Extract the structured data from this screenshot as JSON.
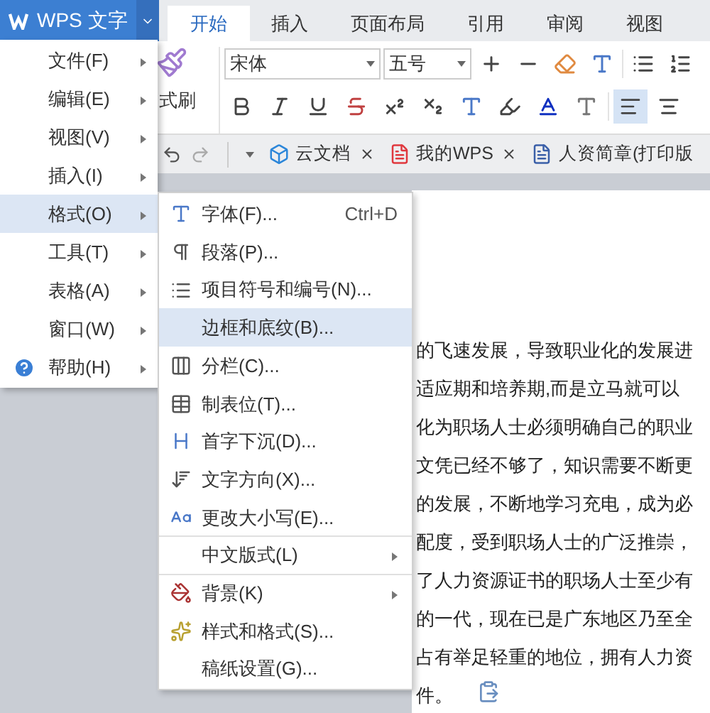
{
  "app_button": {
    "label": "WPS 文字"
  },
  "tabs": [
    {
      "label": "开始",
      "selected": true
    },
    {
      "label": "插入",
      "selected": false
    },
    {
      "label": "页面布局",
      "selected": false
    },
    {
      "label": "引用",
      "selected": false
    },
    {
      "label": "审阅",
      "selected": false
    },
    {
      "label": "视图",
      "selected": false
    }
  ],
  "ribbon": {
    "format_painter": "式刷",
    "font_name": "宋体",
    "font_size": "五号"
  },
  "doc_tabs": [
    {
      "label": "云文档",
      "kind": "cloud"
    },
    {
      "label": "我的WPS",
      "kind": "wps"
    },
    {
      "label": "人资简章(打印版",
      "kind": "doc"
    }
  ],
  "document": {
    "lines": [
      "的飞速发展，导致职业化的发展进",
      "适应期和培养期,而是立马就可以",
      "化为职场人士必须明确自己的职业",
      "文凭已经不够了，知识需要不断更",
      "的发展，不断地学习充电，成为必",
      "配度，受到职场人士的广泛推崇，",
      "了人力资源证书的职场人士至少有",
      "的一代，现在已是广东地区乃至全",
      "占有举足轻重的地位，拥有人力资",
      "件。"
    ]
  },
  "menu": {
    "items": [
      {
        "label": "文件(F)",
        "kind": "plain",
        "selected": false
      },
      {
        "label": "编辑(E)",
        "kind": "plain",
        "selected": false
      },
      {
        "label": "视图(V)",
        "kind": "plain",
        "selected": false
      },
      {
        "label": "插入(I)",
        "kind": "plain",
        "selected": false
      },
      {
        "label": "格式(O)",
        "kind": "plain",
        "selected": true
      },
      {
        "label": "工具(T)",
        "kind": "plain",
        "selected": false
      },
      {
        "label": "表格(A)",
        "kind": "plain",
        "selected": false
      },
      {
        "label": "窗口(W)",
        "kind": "plain",
        "selected": false
      },
      {
        "label": "帮助(H)",
        "kind": "help",
        "selected": false
      }
    ]
  },
  "submenu": {
    "items": [
      {
        "label": "字体(F)...",
        "shortcut": "Ctrl+D",
        "kind": "font",
        "selected": false,
        "divider_before": false
      },
      {
        "label": "段落(P)...",
        "kind": "paragraph",
        "selected": false,
        "divider_before": false
      },
      {
        "label": "项目符号和编号(N)...",
        "kind": "list",
        "selected": false,
        "divider_before": false
      },
      {
        "label": "边框和底纹(B)...",
        "kind": "none",
        "selected": true,
        "divider_before": false
      },
      {
        "label": "分栏(C)...",
        "kind": "columns",
        "selected": false,
        "divider_before": false
      },
      {
        "label": "制表位(T)...",
        "kind": "tabs",
        "selected": false,
        "divider_before": false
      },
      {
        "label": "首字下沉(D)...",
        "kind": "dropcap",
        "selected": false,
        "divider_before": false
      },
      {
        "label": "文字方向(X)...",
        "kind": "direction",
        "selected": false,
        "divider_before": false
      },
      {
        "label": "更改大小写(E)...",
        "kind": "case",
        "selected": false,
        "divider_before": false
      },
      {
        "label": "中文版式(L)",
        "kind": "none",
        "submenu": true,
        "selected": false,
        "divider_before": true
      },
      {
        "label": "背景(K)",
        "kind": "background",
        "submenu": true,
        "selected": false,
        "divider_before": true
      },
      {
        "label": "样式和格式(S)...",
        "kind": "styles",
        "selected": false,
        "divider_before": false
      },
      {
        "label": "稿纸设置(G)...",
        "kind": "none",
        "selected": false,
        "divider_before": false
      }
    ]
  }
}
